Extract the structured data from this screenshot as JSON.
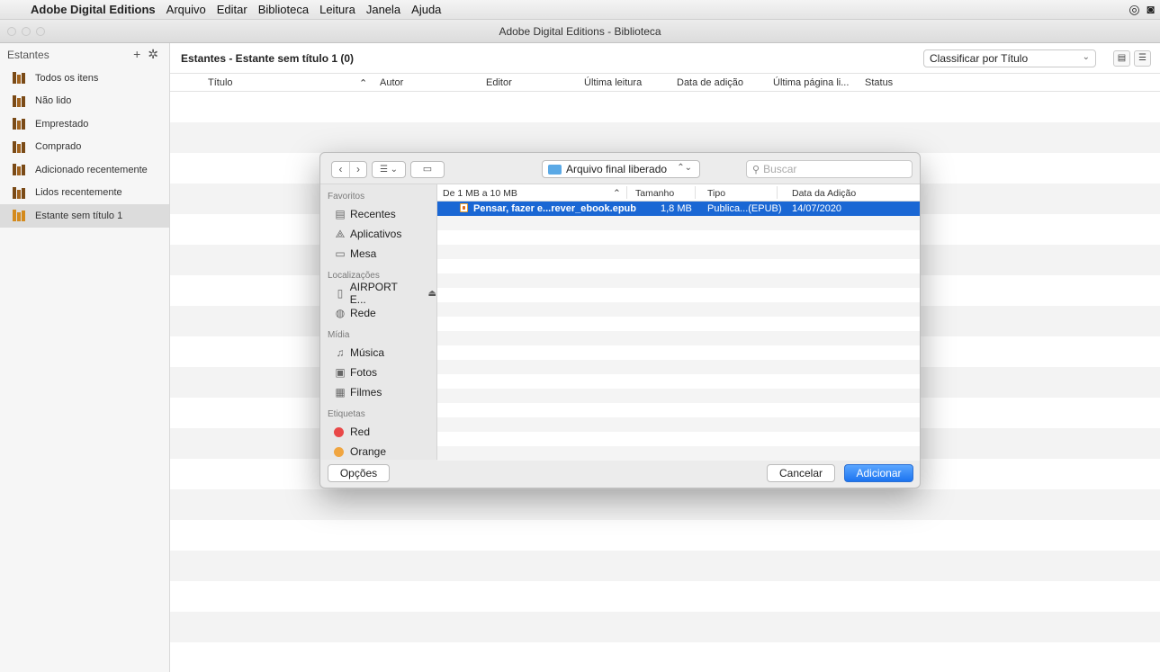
{
  "menubar": {
    "apple_icon": "apple-logo-icon",
    "app_name": "Adobe Digital Editions",
    "menus": [
      "Arquivo",
      "Editar",
      "Biblioteca",
      "Leitura",
      "Janela",
      "Ajuda"
    ],
    "status_icons": [
      "creative-cloud-icon",
      "app-status-icon"
    ]
  },
  "window": {
    "title": "Adobe Digital Editions - Biblioteca"
  },
  "sidebar": {
    "header": "Estantes",
    "add_icon": "+",
    "gear_icon": "✲",
    "items": [
      {
        "label": "Todos os itens"
      },
      {
        "label": "Não lido"
      },
      {
        "label": "Emprestado"
      },
      {
        "label": "Comprado"
      },
      {
        "label": "Adicionado recentemente"
      },
      {
        "label": "Lidos recentemente"
      },
      {
        "label": "Estante sem título 1",
        "selected": true
      }
    ]
  },
  "main": {
    "heading": "Estantes - Estante sem título 1 (0)",
    "sort_selected": "Classificar por Título",
    "columns": [
      "Título",
      "Autor",
      "Editor",
      "Última leitura",
      "Data de adição",
      "Última página li...",
      "Status"
    ]
  },
  "dialog": {
    "location": "Arquivo final liberado",
    "search_placeholder": "Buscar",
    "sections": {
      "favoritos": "Favoritos",
      "localizacoes": "Localizações",
      "midia": "Mídia",
      "etiquetas": "Etiquetas"
    },
    "favoritos": [
      "Recentes",
      "Aplicativos",
      "Mesa"
    ],
    "localizacoes": [
      "AIRPORT E...",
      "Rede"
    ],
    "midia": [
      "Música",
      "Fotos",
      "Filmes"
    ],
    "etiquetas": [
      {
        "label": "Red",
        "color": "#e94848"
      },
      {
        "label": "Orange",
        "color": "#f0a540"
      }
    ],
    "columns": {
      "group": "De 1 MB a 10 MB",
      "size": "Tamanho",
      "type": "Tipo",
      "date": "Data da Adição"
    },
    "files": [
      {
        "name": "Pensar, fazer e...rever_ebook.epub",
        "size": "1,8 MB",
        "type": "Publica...(EPUB)",
        "date": "14/07/2020",
        "selected": true
      }
    ],
    "options_button": "Opções",
    "cancel_button": "Cancelar",
    "add_button": "Adicionar"
  },
  "colors": {
    "selection_blue": "#1a67d4",
    "primary_button": "#1c74f0",
    "shelf_brown": "#7a4a16",
    "shelf_selected": "#d48a1c"
  }
}
